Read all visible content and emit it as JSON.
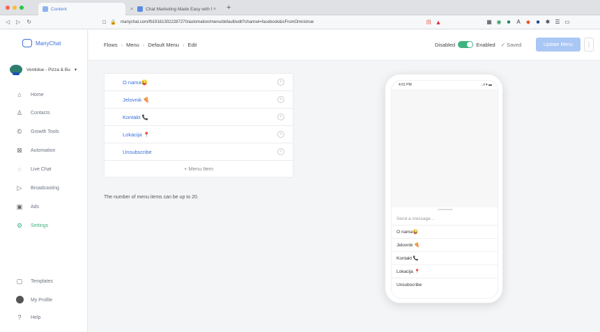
{
  "browser": {
    "tabs": [
      {
        "label": "Content",
        "active": true
      },
      {
        "label": "Chat Marketing Made Easy with Ma",
        "active": false
      }
    ],
    "url": "manychat.com/fb191613022287270/automation/menu/default/edit?channel=facebook&isFromOmnistrue"
  },
  "sidebar": {
    "logo": "ManyChat",
    "page_name": "Ventidue - Pizza & Bu",
    "items": [
      {
        "label": "Home",
        "icon": "home-icon",
        "glyph": "⌂"
      },
      {
        "label": "Contacts",
        "icon": "contacts-icon",
        "glyph": "♙"
      },
      {
        "label": "Growth Tools",
        "icon": "growth-tools-icon",
        "glyph": "©"
      },
      {
        "label": "Automation",
        "icon": "automation-icon",
        "glyph": "⊠"
      },
      {
        "label": "Live Chat",
        "icon": "live-chat-icon",
        "glyph": "◌"
      },
      {
        "label": "Broadcasting",
        "icon": "broadcasting-icon",
        "glyph": "▷"
      },
      {
        "label": "Ads",
        "icon": "ads-icon",
        "glyph": "▣"
      },
      {
        "label": "Settings",
        "icon": "settings-icon",
        "glyph": "⚙"
      }
    ],
    "bottom": [
      {
        "label": "Templates",
        "icon": "templates-icon",
        "glyph": "▢"
      },
      {
        "label": "My Profile",
        "icon": "profile-icon",
        "glyph": ""
      },
      {
        "label": "Help",
        "icon": "help-icon",
        "glyph": "?"
      }
    ]
  },
  "header": {
    "breadcrumb": [
      "Flows",
      "Menu",
      "Default Menu",
      "Edit"
    ],
    "disabled_label": "Disabled",
    "enabled_label": "Enabled",
    "saved_label": "✓ Saved",
    "update_button": "Update Menu",
    "more": "⋮"
  },
  "menu": {
    "items": [
      "O nama😜",
      "Jelovnik 🍕",
      "Kontakt 📞",
      "Lokacija 📍",
      "Unsubscribe"
    ],
    "add_item": "+ Menu Item",
    "hint": "The number of menu items can be up to 20."
  },
  "preview": {
    "time": "4:01 PM",
    "signal": "..ıl ▾ ▬",
    "placeholder": "Send a message...",
    "items": [
      "O nama😜",
      "Jelovnik 🍕",
      "Kontakt 📞",
      "Lokacija 📍",
      "Unsubscribe"
    ]
  },
  "colors": {
    "accent": "#3a6fd8",
    "active": "#3fb37f",
    "update_button": "#a9c7f5"
  }
}
